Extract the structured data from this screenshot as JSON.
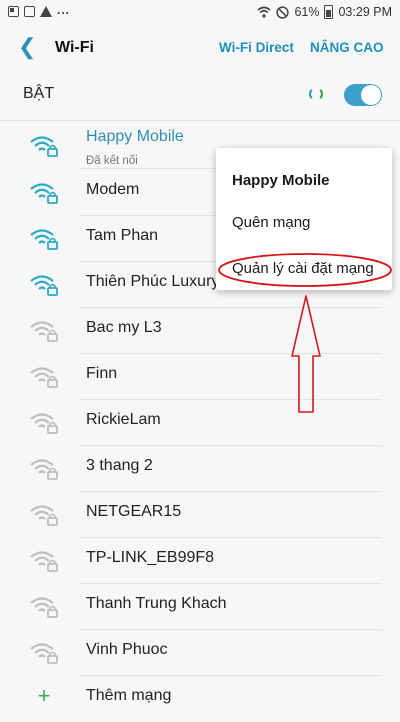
{
  "status_bar": {
    "left_icons": [
      "notification-square-icon",
      "notification-square-icon",
      "warning-icon"
    ],
    "more": "...",
    "battery_percent": "61%",
    "time": "03:29 PM",
    "right_icons": [
      "wifi-icon",
      "do-not-disturb-icon",
      "battery-icon"
    ]
  },
  "header": {
    "back_icon": "back-arrow-icon",
    "title": "Wi-Fi",
    "wifi_direct": "Wi-Fi Direct",
    "advanced": "NÂNG CAO"
  },
  "wifi_toggle": {
    "label": "BẬT",
    "on": true,
    "accent": "#3ba0cb"
  },
  "networks": [
    {
      "name": "Happy Mobile",
      "status": "Đã kết nối",
      "connected": true,
      "signal": "strong",
      "secured": true
    },
    {
      "name": "Modem",
      "signal": "strong",
      "secured": true
    },
    {
      "name": "Tam Phan",
      "signal": "strong",
      "secured": true
    },
    {
      "name": "Thiên Phúc Luxury",
      "signal": "strong",
      "secured": true
    },
    {
      "name": "Bac my L3",
      "signal": "weak",
      "secured": true
    },
    {
      "name": "Finn",
      "signal": "weak",
      "secured": true
    },
    {
      "name": "RickieLam",
      "signal": "weak",
      "secured": true
    },
    {
      "name": "3 thang 2",
      "signal": "weak",
      "secured": true
    },
    {
      "name": "NETGEAR15",
      "signal": "weak",
      "secured": true
    },
    {
      "name": "TP-LINK_EB99F8",
      "signal": "weak",
      "secured": true
    },
    {
      "name": "Thanh Trung Khach",
      "signal": "weak",
      "secured": true
    },
    {
      "name": "Vinh Phuoc",
      "signal": "weak",
      "secured": true
    }
  ],
  "add_network": {
    "label": "Thêm mạng",
    "icon": "plus-icon"
  },
  "context_menu": {
    "title": "Happy Mobile",
    "items": [
      "Quên mạng",
      "Quản lý cài đặt mạng"
    ]
  },
  "annotation": {
    "color": "#d8141b"
  },
  "colors": {
    "connected_text": "#2f8fb3",
    "strong_signal": "#2aa8c4",
    "weak_signal": "#bdbdbd"
  }
}
